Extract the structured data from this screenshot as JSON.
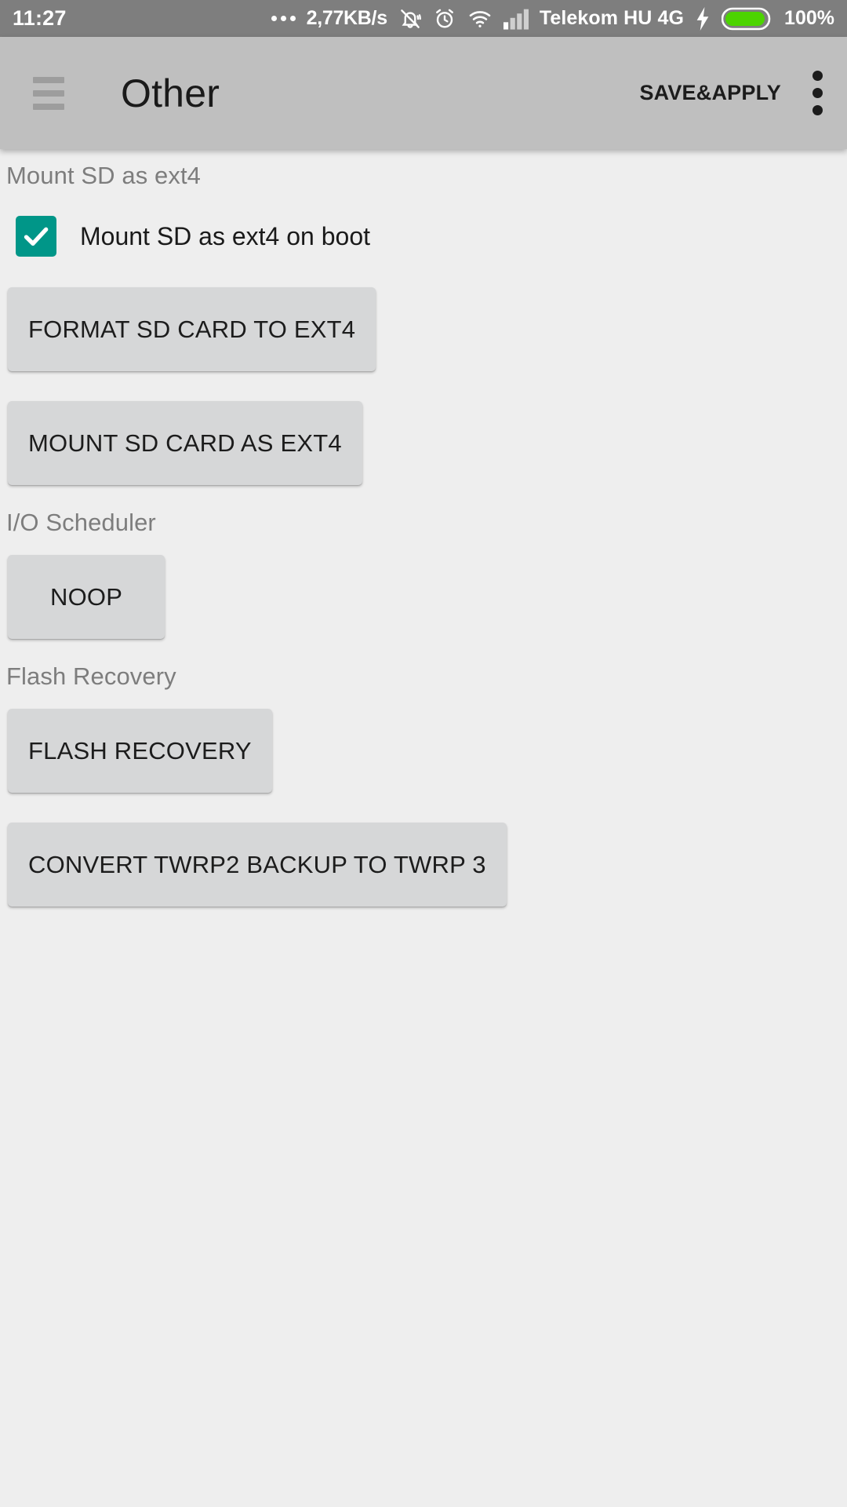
{
  "status_bar": {
    "clock": "11:27",
    "overflow_dots_icon": "more-dots-icon",
    "network_speed": "2,77KB/s",
    "silent_icon": "bell-muted-icon",
    "alarm_icon": "alarm-clock-icon",
    "wifi_icon": "wifi-icon",
    "signal_icon": "cellular-signal-icon",
    "carrier": "Telekom HU 4G",
    "charging_icon": "lightning-bolt-icon",
    "battery_icon": "battery-full-icon",
    "battery_level": "100%",
    "battery_color": "#4cd400",
    "background": "#7e7e7e",
    "foreground": "#ffffff"
  },
  "app_bar": {
    "menu_icon": "hamburger-menu-icon",
    "title": "Other",
    "save_label": "SAVE&APPLY",
    "overflow_icon": "overflow-menu-icon",
    "background": "#bfbfbf"
  },
  "theme": {
    "accent": "#009688",
    "page_background": "#eeeeee",
    "button_background": "#d6d7d8",
    "section_label_color": "#7d7d7d"
  },
  "sections": [
    {
      "label": "Mount SD as ext4",
      "checkbox": {
        "label": "Mount SD as ext4 on boot",
        "checked": true
      },
      "buttons": [
        "FORMAT SD CARD TO EXT4",
        "MOUNT SD CARD AS EXT4"
      ]
    },
    {
      "label": "I/O Scheduler",
      "buttons": [
        "NOOP"
      ]
    },
    {
      "label": "Flash Recovery",
      "buttons": [
        "FLASH RECOVERY",
        "CONVERT TWRP2 BACKUP TO TWRP 3"
      ]
    }
  ]
}
